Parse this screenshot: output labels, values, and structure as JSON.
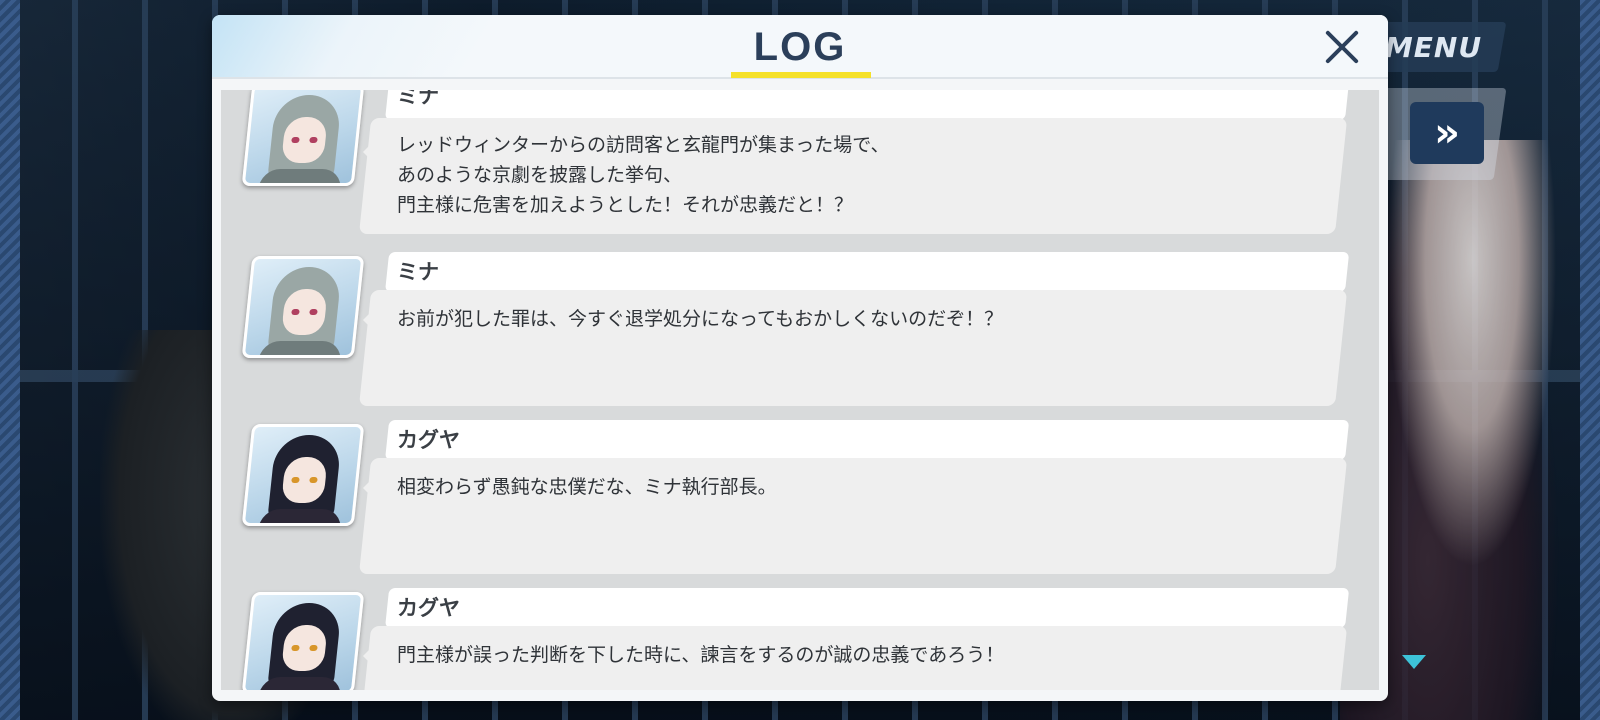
{
  "hud": {
    "menu_label": "MENU",
    "fast_forward_label": "»"
  },
  "log": {
    "title": "LOG",
    "close_label": "",
    "entries": [
      {
        "speaker": "ミナ",
        "portrait": "mina-portrait",
        "text": "レッドウィンターからの訪問客と玄龍門が集まった場で、\nあのような京劇を披露した挙句、\n門主様に危害を加えようとした！それが忠義だと！？"
      },
      {
        "speaker": "ミナ",
        "portrait": "mina-portrait",
        "text": "お前が犯した罪は、今すぐ退学処分になってもおかしくないのだぞ！？"
      },
      {
        "speaker": "カグヤ",
        "portrait": "kaguya-portrait",
        "text": "相変わらず愚鈍な忠僕だな、ミナ執行部長。"
      },
      {
        "speaker": "カグヤ",
        "portrait": "kaguya-portrait",
        "text": "門主様が誤った判断を下した時に、諫言をするのが誠の忠義であろう！"
      }
    ]
  },
  "colors": {
    "title": "#2b3f5a",
    "title_underline": "#f5e12a",
    "bubble": "#efefef",
    "scroll_arrow": "#3dc3d8"
  }
}
